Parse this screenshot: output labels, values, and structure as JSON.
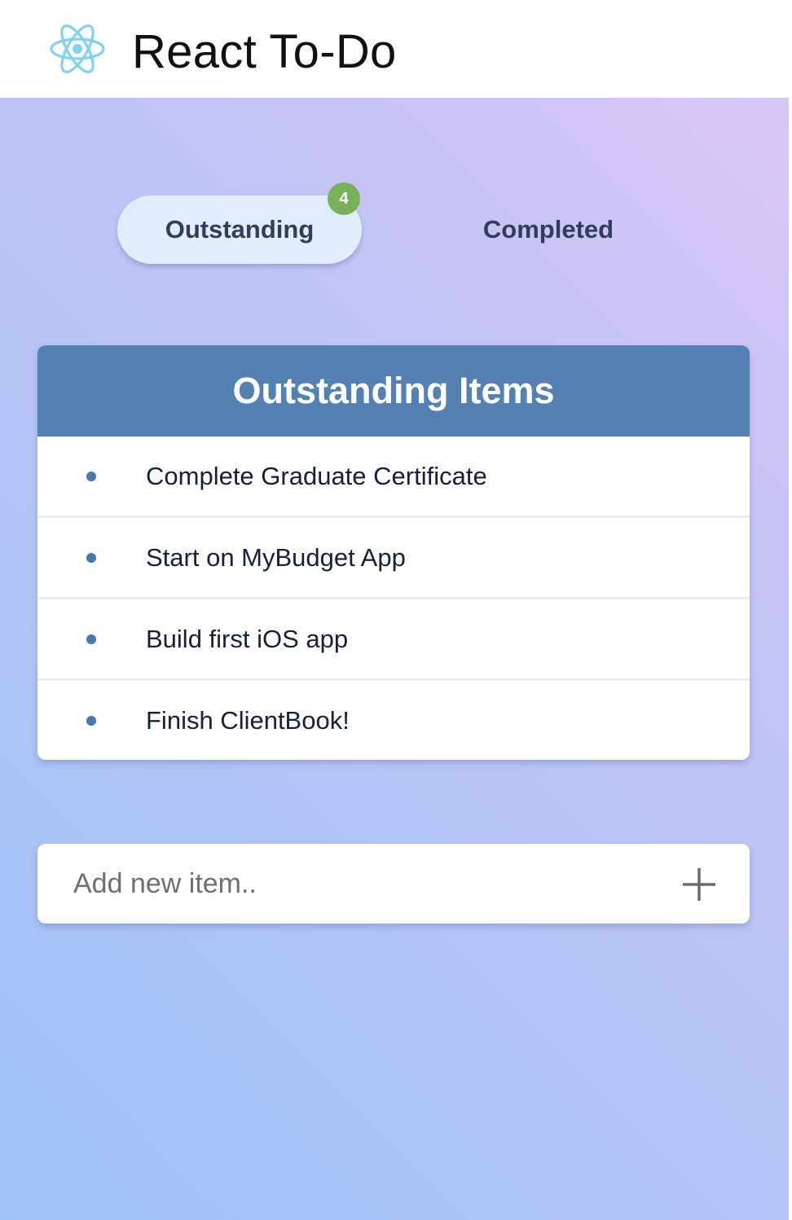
{
  "header": {
    "title": "React To-Do",
    "logo_icon": "react-atom-icon",
    "logo_color": "#7fd3ee"
  },
  "tabs": [
    {
      "label": "Outstanding",
      "active": true,
      "badge_count": "4"
    },
    {
      "label": "Completed",
      "active": false
    }
  ],
  "list": {
    "title": "Outstanding Items",
    "items": [
      {
        "text": "Complete Graduate Certificate"
      },
      {
        "text": "Start on MyBudget App"
      },
      {
        "text": "Build first iOS app"
      },
      {
        "text": "Finish ClientBook!"
      }
    ]
  },
  "add_item": {
    "placeholder": "Add new item..",
    "value": "",
    "button_icon": "plus-icon"
  },
  "colors": {
    "header_bar": "#5481b2",
    "badge": "#78b15a",
    "active_tab": "#e2edfb",
    "bullet": "#4a78ae"
  }
}
